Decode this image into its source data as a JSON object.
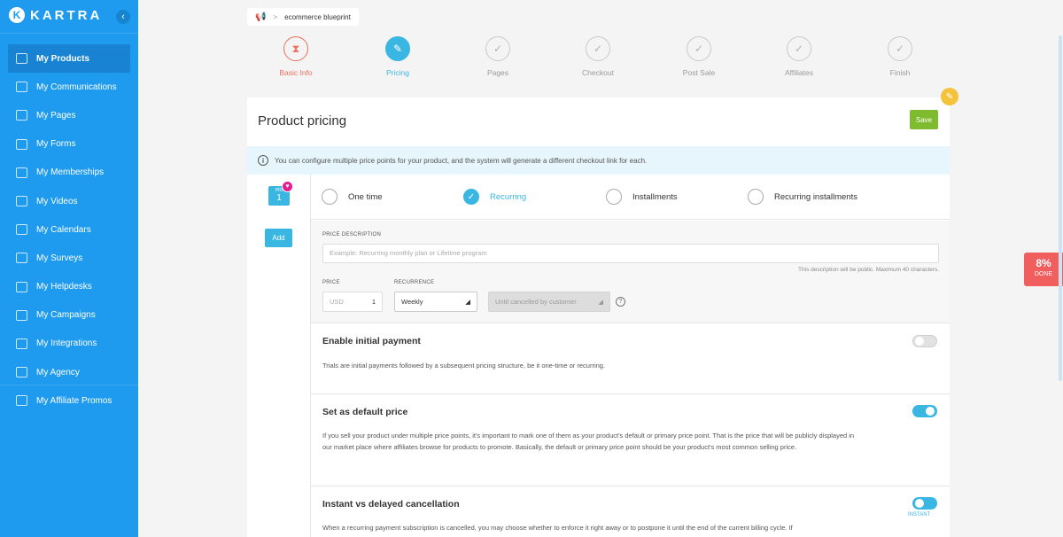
{
  "sidebar": {
    "logo_text": "KARTRA",
    "logo_mark": "K",
    "collapse_icon": "chevron-left-icon",
    "items": [
      {
        "label": "My Products",
        "icon": "megaphone-icon",
        "active": true
      },
      {
        "label": "My Communications",
        "icon": "people-icon"
      },
      {
        "label": "My Pages",
        "icon": "pages-icon"
      },
      {
        "label": "My Forms",
        "icon": "form-icon"
      },
      {
        "label": "My Memberships",
        "icon": "members-icon"
      },
      {
        "label": "My Videos",
        "icon": "video-icon"
      },
      {
        "label": "My Calendars",
        "icon": "calendar-icon"
      },
      {
        "label": "My Surveys",
        "icon": "checkbox-icon"
      },
      {
        "label": "My Helpdesks",
        "icon": "headset-icon"
      },
      {
        "label": "My Campaigns",
        "icon": "sitemap-icon"
      },
      {
        "label": "My Integrations",
        "icon": "share-icon"
      },
      {
        "label": "My Agency",
        "icon": "building-icon"
      },
      {
        "label": "My Affiliate Promos",
        "icon": "bullhorn-icon"
      }
    ]
  },
  "breadcrumb": {
    "icon": "megaphone-icon",
    "separator": ">",
    "current": "ecommerce blueprint"
  },
  "steps": [
    {
      "label": "Basic Info",
      "state": "error",
      "icon": "hourglass-icon"
    },
    {
      "label": "Pricing",
      "state": "current",
      "icon": "pencil-icon"
    },
    {
      "label": "Pages",
      "state": "pending",
      "icon": "check-icon"
    },
    {
      "label": "Checkout",
      "state": "pending",
      "icon": "check-icon"
    },
    {
      "label": "Post Sale",
      "state": "pending",
      "icon": "check-icon"
    },
    {
      "label": "Affiliates",
      "state": "pending",
      "icon": "check-icon"
    },
    {
      "label": "Finish",
      "state": "pending",
      "icon": "check-icon"
    }
  ],
  "card": {
    "title": "Product pricing",
    "save_label": "Save",
    "info_text": "You can configure multiple price points for your product, and the system will generate a different checkout link for each."
  },
  "price_point": {
    "badge_label": "PRI",
    "badge_number": "1",
    "add_label": "Add"
  },
  "types": [
    {
      "label": "One time",
      "checked": false
    },
    {
      "label": "Recurring",
      "checked": true
    },
    {
      "label": "Installments",
      "checked": false
    },
    {
      "label": "Recurring installments",
      "checked": false
    }
  ],
  "form": {
    "description_label": "PRICE DESCRIPTION",
    "description_placeholder": "Example: Recurring monthly plan or Lifetime program",
    "description_hint": "This description will be public. Maximum 40 characters.",
    "price_label": "PRICE",
    "currency": "USD",
    "price_value": "1",
    "recurrence_label": "RECURRENCE",
    "recurrence_value": "Weekly",
    "duration_value": "Until cancelled by customer"
  },
  "sections": [
    {
      "title": "Enable initial payment",
      "text": "Trials are initial payments followed by a subsequent pricing structure, be it one-time or recurring.",
      "toggle": "off"
    },
    {
      "title": "Set as default price",
      "text": "If you sell your product under multiple price points, it's important to mark one of them as your product's default or primary price point. That is the price that will be publicly displayed in our market place where affiliates browse for products to promote. Basically, the default or primary price point should be your product's most common selling price.",
      "toggle": "on"
    },
    {
      "title": "Instant vs delayed cancellation",
      "text": "When a recurring payment subscription is cancelled, you may choose whether to enforce it right away or to postpone it until the end of the current billing cycle. If",
      "toggle": "on",
      "toggle_label": "INSTANT"
    }
  ],
  "progress": {
    "percent_text": "8%",
    "percent_value": 8,
    "label": "DONE"
  },
  "colors": {
    "sidebar": "#1e9bef",
    "accent": "#3ab6e3",
    "save": "#7fbb2e",
    "error_step": "#e9715d",
    "progress": "#f15e5e"
  }
}
